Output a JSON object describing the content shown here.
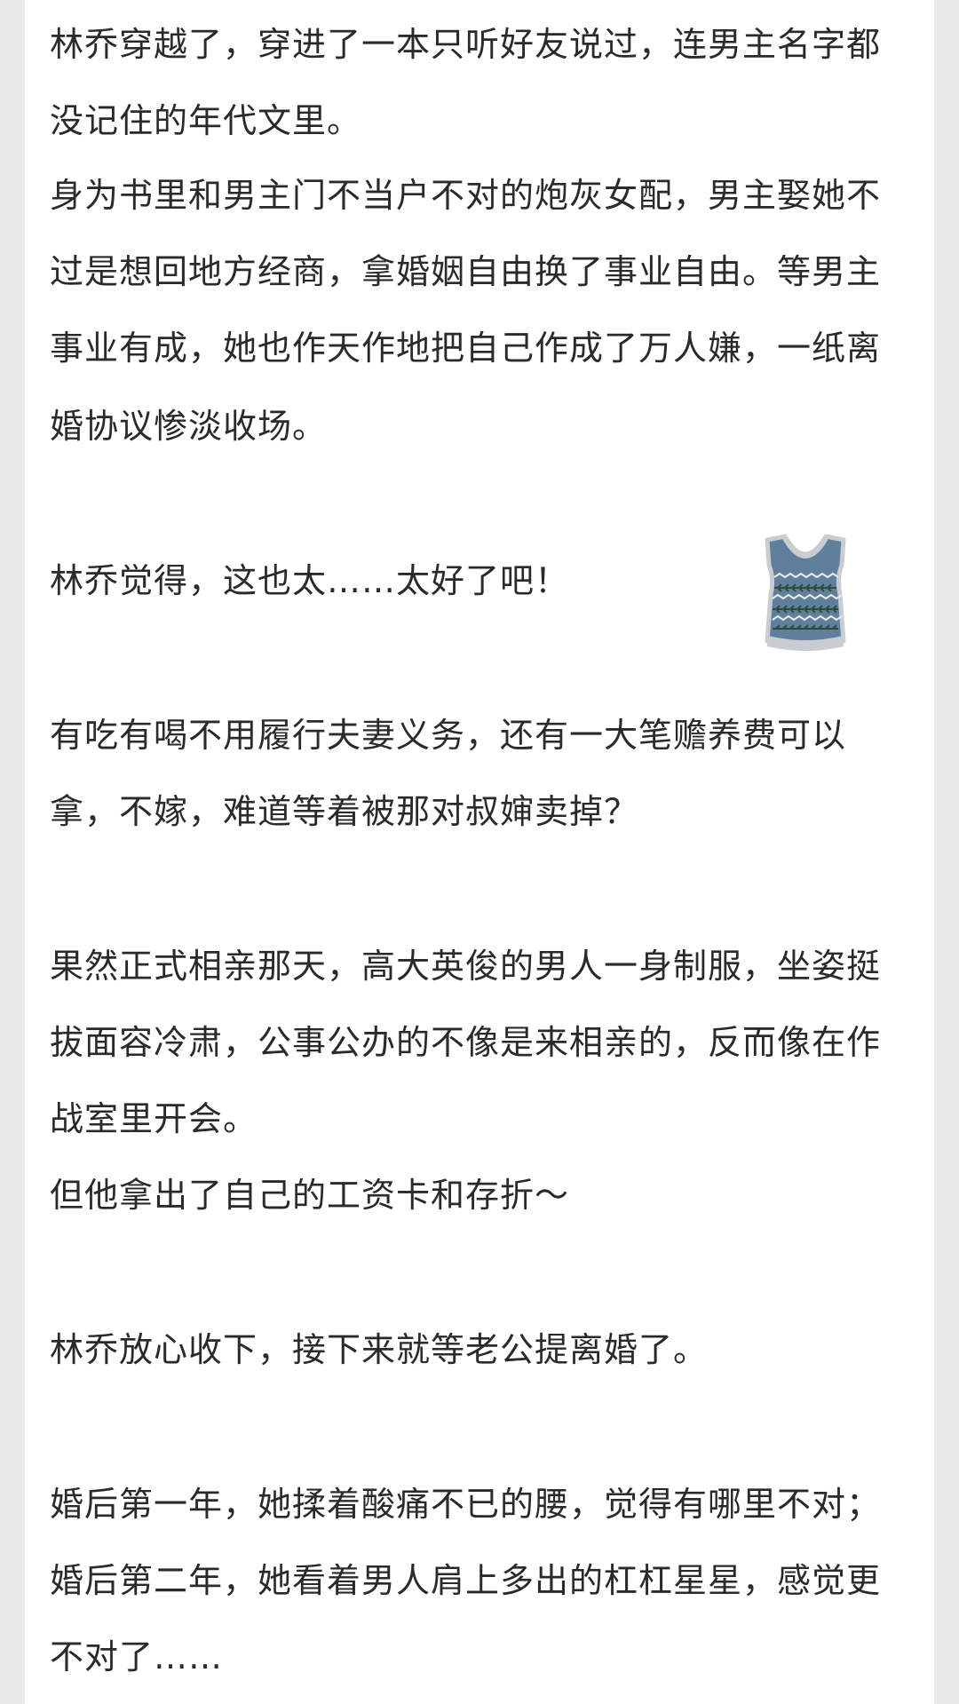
{
  "paragraphs": [
    {
      "lines": [
        "林乔穿越了，穿进了一本只听好友说过，连男主名字都",
        "没记住的年代文里。"
      ]
    },
    {
      "lines": [
        "身为书里和男主门不当户不对的炮灰女配，男主娶她不",
        "过是想回地方经商，拿婚姻自由换了事业自由。等男主",
        "事业有成，她也作天作地把自己作成了万人嫌，一纸离",
        "婚协议惨淡收场。"
      ]
    },
    {
      "lines": [
        "林乔觉得，这也太……太好了吧！"
      ]
    },
    {
      "lines": [
        "有吃有喝不用履行夫妻义务，还有一大笔赡养费可以",
        "拿，不嫁，难道等着被那对叔婶卖掉？"
      ]
    },
    {
      "lines": [
        "果然正式相亲那天，高大英俊的男人一身制服，坐姿挺",
        "拔面容冷肃，公事公办的不像是来相亲的，反而像在作",
        "战室里开会。",
        "但他拿出了自己的工资卡和存折～"
      ]
    },
    {
      "lines": [
        "林乔放心收下，接下来就等老公提离婚了。"
      ]
    },
    {
      "lines": [
        "婚后第一年，她揉着酸痛不已的腰，觉得有哪里不对；",
        "婚后第二年，她看着男人肩上多出的杠杠星星，感觉更",
        "不对了……"
      ]
    }
  ],
  "sticker": {
    "icon": "knit-vest-icon",
    "colors": {
      "body": "#5f7f9c",
      "trim": "#c9ccd0",
      "pattern": "#e8eef4",
      "leaf": "#2e4a3a"
    }
  }
}
